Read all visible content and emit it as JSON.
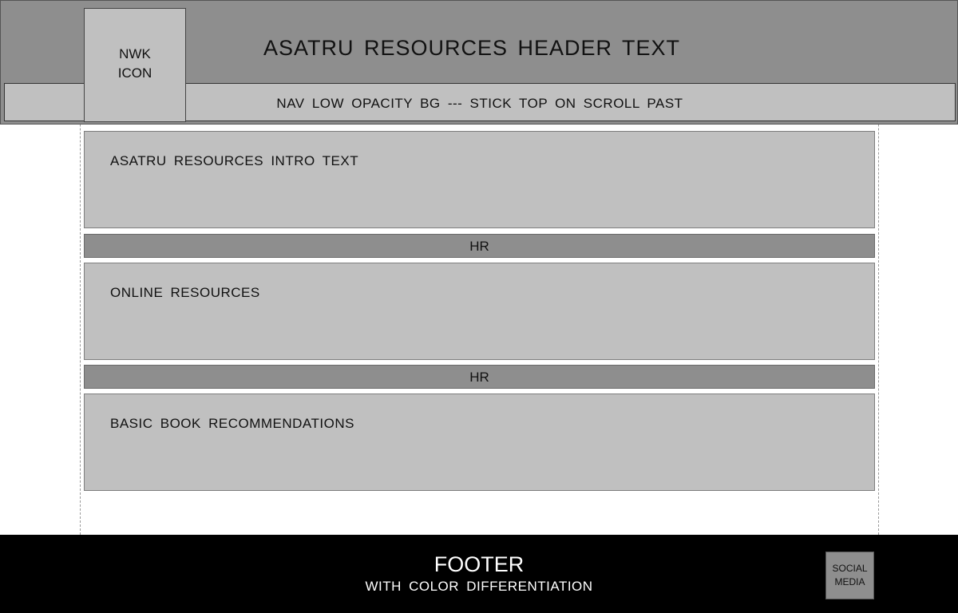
{
  "header": {
    "title": "ASATRU RESOURCES HEADER TEXT",
    "logo_label": "NWK\nICON",
    "nav_text": "NAV LOW OPACITY BG --- STICK TOP ON SCROLL PAST"
  },
  "sections": [
    {
      "label": "ASATRU RESOURCES INTRO TEXT"
    },
    {
      "label": "ONLINE RESOURCES"
    },
    {
      "label": "BASIC BOOK RECOMMENDATIONS"
    }
  ],
  "dividers": [
    {
      "label": "HR"
    },
    {
      "label": "HR"
    }
  ],
  "footer": {
    "title": "FOOTER",
    "subtitle": "WITH COLOR DIFFERENTIATION",
    "social_label": "SOCIAL\nMEDIA"
  },
  "colors": {
    "header_bg": "#8e8e8e",
    "panel_bg": "#c0c0c0",
    "divider_bg": "#8e8e8e",
    "footer_bg": "#000000",
    "footer_text": "#ffffff"
  }
}
